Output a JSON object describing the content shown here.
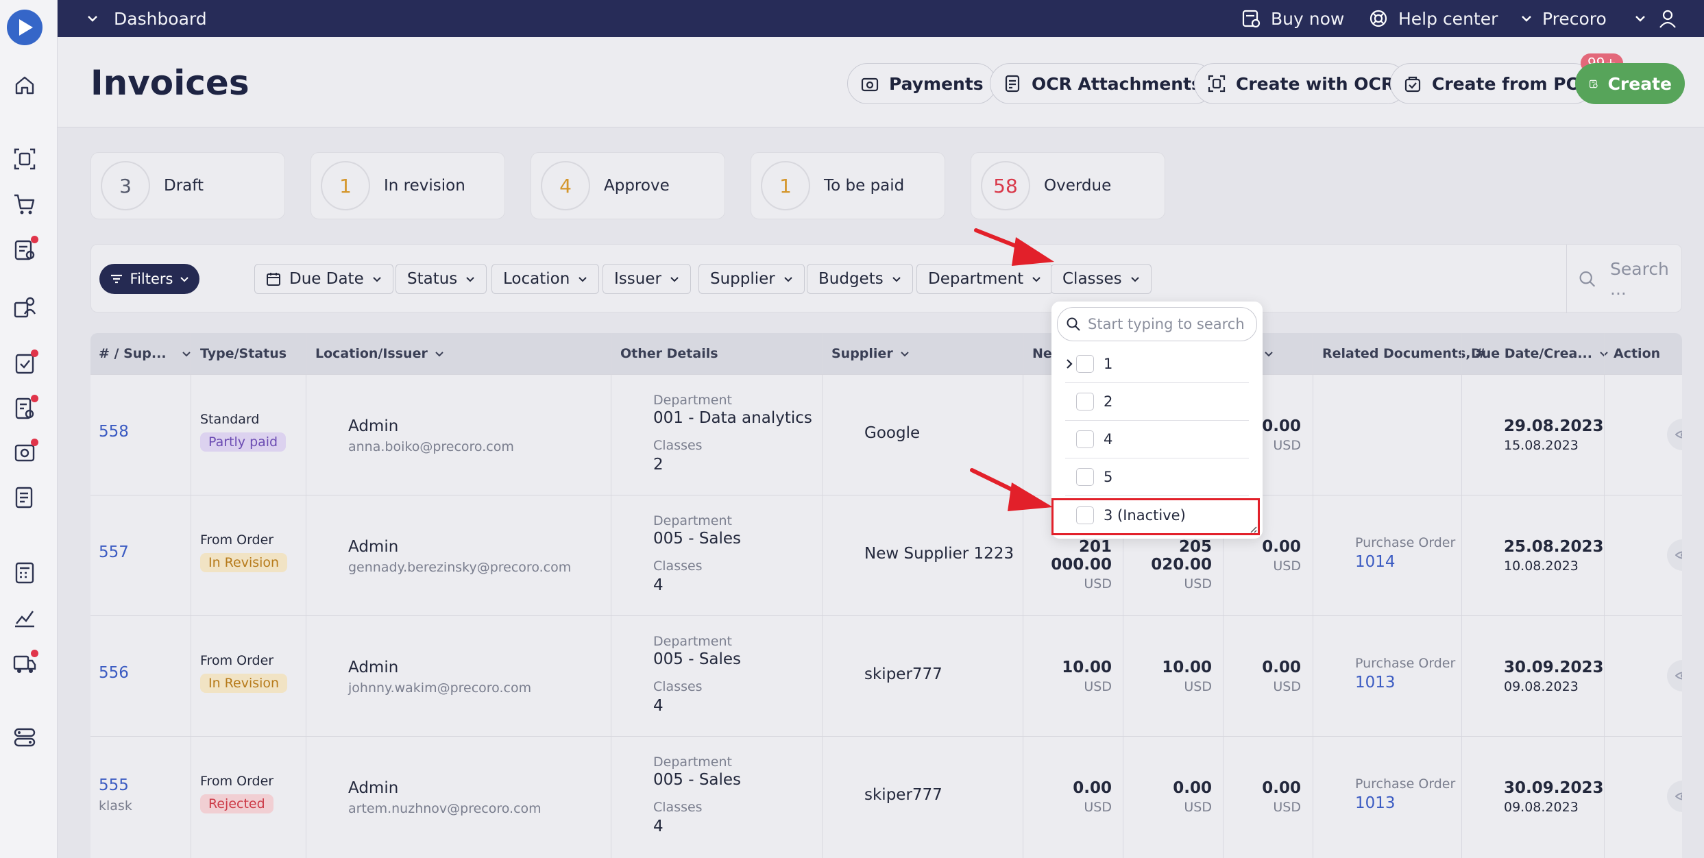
{
  "topbar": {
    "breadcrumb": "Dashboard",
    "buy_now": "Buy now",
    "help_center": "Help center",
    "company": "Precoro"
  },
  "page": {
    "title": "Invoices",
    "buttons": {
      "payments": "Payments",
      "ocr_attachments": "OCR Attachments",
      "create_with_ocr": "Create with OCR",
      "create_from_po": "Create from PO",
      "create_from_po_badge": "99+",
      "create": "Create"
    }
  },
  "status_cards": [
    {
      "count": "3",
      "label": "Draft",
      "color": "#5b5f70"
    },
    {
      "count": "1",
      "label": "In revision",
      "color": "#d4962b"
    },
    {
      "count": "4",
      "label": "Approve",
      "color": "#d4962b"
    },
    {
      "count": "1",
      "label": "To be paid",
      "color": "#d4962b"
    },
    {
      "count": "58",
      "label": "Overdue",
      "color": "#d9394a"
    }
  ],
  "filters": {
    "filters_label": "Filters",
    "chips": [
      "Due Date",
      "Status",
      "Location",
      "Issuer",
      "Supplier",
      "Budgets",
      "Department",
      "Classes"
    ],
    "search_placeholder": "Search ..."
  },
  "dropdown": {
    "search_placeholder": "Start typing to search",
    "items": [
      "1",
      "2",
      "4",
      "5",
      "3 (Inactive)"
    ]
  },
  "table": {
    "headers": {
      "num": "# / Sup...",
      "type": "Type/Status",
      "location": "Location/Issuer",
      "other": "Other Details",
      "supplier": "Supplier",
      "net": "Net",
      "related": "Related Documents, #",
      "due": "Due Date/Crea...",
      "action": "Action"
    },
    "rows": [
      {
        "num": "558",
        "sub": "",
        "type": "Standard",
        "status": "Partly paid",
        "status_kind": "partly",
        "issuer": "Admin",
        "email": "anna.boiko@precoro.com",
        "dept_label": "Department",
        "dept": "001 - Data analytics",
        "class_label": "Classes",
        "class": "2",
        "supplier": "Google",
        "amt1": "",
        "amt2": "",
        "amt3": "60.00",
        "currency": "USD",
        "rel_label": "",
        "rel": "",
        "due": "29.08.2023",
        "created": "15.08.2023"
      },
      {
        "num": "557",
        "sub": "",
        "type": "From Order",
        "status": "In Revision",
        "status_kind": "revision",
        "issuer": "Admin",
        "email": "gennady.berezinsky@precoro.com",
        "dept_label": "Department",
        "dept": "005 - Sales",
        "class_label": "Classes",
        "class": "4",
        "supplier": "New Supplier 1223",
        "amt1": "201 000.00",
        "amt2": "205 020.00",
        "amt3": "0.00",
        "currency": "USD",
        "rel_label": "Purchase Order",
        "rel": "1014",
        "due": "25.08.2023",
        "created": "10.08.2023"
      },
      {
        "num": "556",
        "sub": "",
        "type": "From Order",
        "status": "In Revision",
        "status_kind": "revision",
        "issuer": "Admin",
        "email": "johnny.wakim@precoro.com",
        "dept_label": "Department",
        "dept": "005 - Sales",
        "class_label": "Classes",
        "class": "4",
        "supplier": "skiper777",
        "amt1": "10.00",
        "amt2": "10.00",
        "amt3": "0.00",
        "currency": "USD",
        "rel_label": "Purchase Order",
        "rel": "1013",
        "due": "30.09.2023",
        "created": "09.08.2023"
      },
      {
        "num": "555",
        "sub": "klask",
        "type": "From Order",
        "status": "Rejected",
        "status_kind": "rejected",
        "issuer": "Admin",
        "email": "artem.nuzhnov@precoro.com",
        "dept_label": "Department",
        "dept": "005 - Sales",
        "class_label": "Classes",
        "class": "4",
        "supplier": "skiper777",
        "amt1": "0.00",
        "amt2": "0.00",
        "amt3": "0.00",
        "currency": "USD",
        "rel_label": "Purchase Order",
        "rel": "1013",
        "due": "30.09.2023",
        "created": "09.08.2023"
      }
    ]
  },
  "colors": {
    "topbar": "#272c58",
    "accent_blue": "#3b5bc2",
    "create_green": "#57a45a",
    "annotation_red": "#e2202a"
  }
}
